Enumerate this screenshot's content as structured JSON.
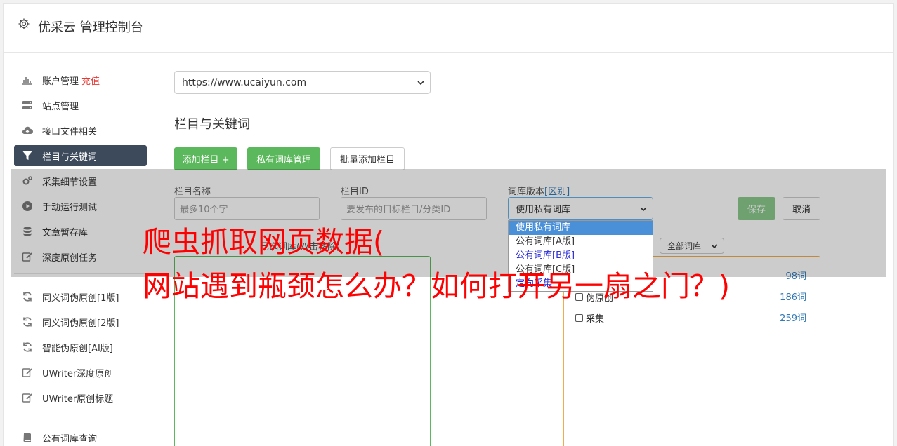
{
  "header": {
    "title": "优采云 管理控制台"
  },
  "sidebar": {
    "items": [
      {
        "label": "账户管理",
        "badge": "充值",
        "icon": "bar-chart-icon"
      },
      {
        "label": "站点管理",
        "icon": "server-icon"
      },
      {
        "label": "接口文件相关",
        "icon": "cloud-upload-icon"
      },
      {
        "label": "栏目与关键词",
        "icon": "filter-icon",
        "active": true
      },
      {
        "label": "采集细节设置",
        "icon": "gears-icon"
      },
      {
        "label": "手动运行测试",
        "icon": "play-circle-icon"
      },
      {
        "label": "文章暂存库",
        "icon": "database-icon"
      },
      {
        "label": "深度原创任务",
        "icon": "edit-icon"
      },
      {
        "label": "同义词伪原创[1版]",
        "icon": "refresh-icon"
      },
      {
        "label": "同义词伪原创[2版]",
        "icon": "refresh-icon"
      },
      {
        "label": "智能伪原创[AI版]",
        "icon": "refresh-icon"
      },
      {
        "label": "UWriter深度原创",
        "icon": "edit-icon"
      },
      {
        "label": "UWriter原创标题",
        "icon": "edit-icon"
      },
      {
        "label": "公有词库查询",
        "icon": "book-icon"
      }
    ]
  },
  "main": {
    "site_select": {
      "value": "https://www.ucaiyun.com"
    },
    "section_title": "栏目与关键词",
    "buttons": {
      "add_column": "添加栏目 +",
      "private_lib": "私有词库管理",
      "batch_add": "批量添加栏目",
      "save": "保存",
      "cancel": "取消"
    },
    "form": {
      "name_label": "栏目名称",
      "name_placeholder": "最多10个字",
      "id_label": "栏目ID",
      "id_placeholder": "要发布的目标栏目/分类ID",
      "lib_label": "词库版本",
      "lib_label_link": "[区别]",
      "lib_value": "使用私有词库",
      "lib_options": [
        "使用私有词库",
        "公有词库[A版]",
        "公有词库[B版]",
        "公有词库[C版]",
        "定向采集"
      ],
      "filter_value": "全部词库",
      "middle_label": "已选词库(双击移除)"
    },
    "wordlists": [
      {
        "label": "",
        "count": "98词"
      },
      {
        "label": "伪原创",
        "count": "186词"
      },
      {
        "label": "采集",
        "count": "259词"
      }
    ]
  },
  "watermark": {
    "line1": "爬虫抓取网页数据(",
    "line2": "网站遇到瓶颈怎么办？如何打开另一扇之门？)"
  },
  "colors": {
    "green": "#5cb85c",
    "dark_nav": "#3c4a5c",
    "red": "#ff0000",
    "link": "#337ab7"
  }
}
